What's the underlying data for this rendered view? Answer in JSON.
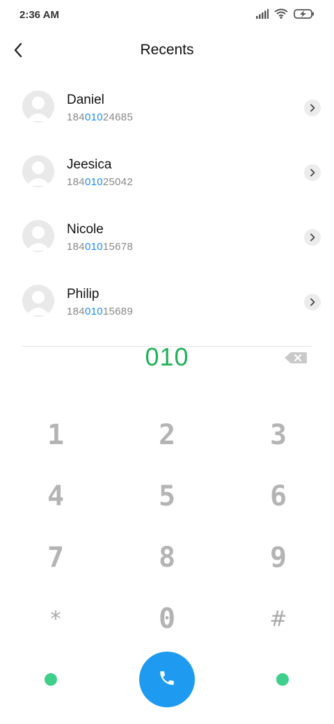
{
  "status": {
    "time": "2:36 AM"
  },
  "header": {
    "title": "Recents"
  },
  "recents": [
    {
      "name": "Daniel",
      "num_prefix": "184",
      "num_match": "010",
      "num_suffix": "24685"
    },
    {
      "name": "Jeesica",
      "num_prefix": "184",
      "num_match": "010",
      "num_suffix": "25042"
    },
    {
      "name": "Nicole",
      "num_prefix": "184",
      "num_match": "010",
      "num_suffix": "15678"
    },
    {
      "name": "Philip",
      "num_prefix": "184",
      "num_match": "010",
      "num_suffix": "15689"
    }
  ],
  "dialer": {
    "input": "010",
    "keys": [
      "1",
      "2",
      "3",
      "4",
      "5",
      "6",
      "7",
      "8",
      "9",
      "*",
      "0",
      "#"
    ]
  },
  "icons": {
    "back": "back-arrow-icon",
    "detail": "chevron-right-icon",
    "backspace": "backspace-icon",
    "call": "phone-icon",
    "signal": "signal-icon",
    "wifi": "wifi-icon",
    "battery": "battery-charging-icon"
  },
  "colors": {
    "match_highlight": "#1a8cff",
    "dial_text": "#1fb15a",
    "call_button": "#1e9bf0",
    "bottom_dots": "#3ecf8a"
  }
}
